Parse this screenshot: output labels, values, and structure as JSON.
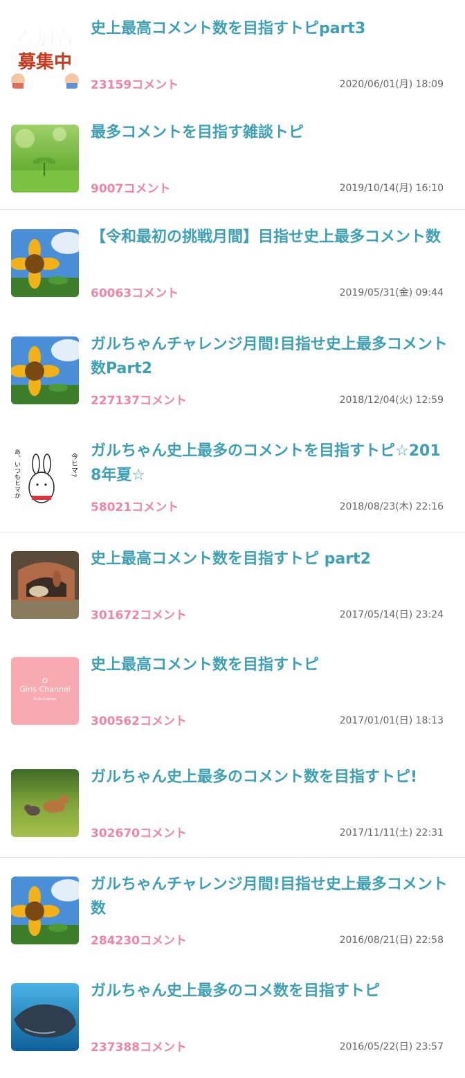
{
  "topics": [
    {
      "title": "史上最高コメント数を目指すトピpart3",
      "comments": "23159コメント",
      "date": "2020/06/01(月) 18:09",
      "thumbnail": "recruiting-illustration",
      "thumbnail_text": [
        "参加者",
        "募集中"
      ]
    },
    {
      "title": "最多コメントを目指す雑談トピ",
      "comments": "9007コメント",
      "date": "2019/10/14(月) 16:10",
      "thumbnail": "sprout-photo"
    },
    {
      "title": "【令和最初の挑戦月間】目指せ史上最多コメント数",
      "comments": "60063コメント",
      "date": "2019/05/31(金) 09:44",
      "thumbnail": "sunflower-photo"
    },
    {
      "title": "ガルちゃんチャレンジ月間!目指せ史上最多コメント数Part2",
      "comments": "227137コメント",
      "date": "2018/12/04(火) 12:59",
      "thumbnail": "sunflower-photo"
    },
    {
      "title": "ガルちゃん史上最多のコメントを目指すトピ☆2018年夏☆",
      "comments": "58021コメント",
      "date": "2018/08/23(木) 22:16",
      "thumbnail": "rabbit-sticker",
      "thumbnail_text": [
        "今ヒマ?",
        "あ、いつもヒマか"
      ]
    },
    {
      "title": "史上最高コメント数を目指すトピ part2",
      "comments": "301672コメント",
      "date": "2017/05/14(日) 23:24",
      "thumbnail": "hamster-photo"
    },
    {
      "title": "史上最高コメント数を目指すトピ",
      "comments": "300562コメント",
      "date": "2017/01/01(日) 18:13",
      "thumbnail": "girls-channel-logo",
      "thumbnail_text": [
        "Girls Channel",
        "Girls Channel"
      ]
    },
    {
      "title": "ガルちゃん史上最多のコメント数を目指すトピ!",
      "comments": "302670コメント",
      "date": "2017/11/11(土) 22:31",
      "thumbnail": "dogs-photo"
    },
    {
      "title": "ガルちゃんチャレンジ月間!目指せ史上最多コメント数",
      "comments": "284230コメント",
      "date": "2016/08/21(日) 22:58",
      "thumbnail": "sunflower-photo"
    },
    {
      "title": "ガルちゃん史上最多のコメ数を目指すトピ",
      "comments": "237388コメント",
      "date": "2016/05/22(日) 23:57",
      "thumbnail": "whale-photo"
    }
  ],
  "colors": {
    "title": "#3f9fb3",
    "comments": "#ec86a3",
    "date": "#666666",
    "divider": "#e3e3e3",
    "background": "#ffffff"
  }
}
